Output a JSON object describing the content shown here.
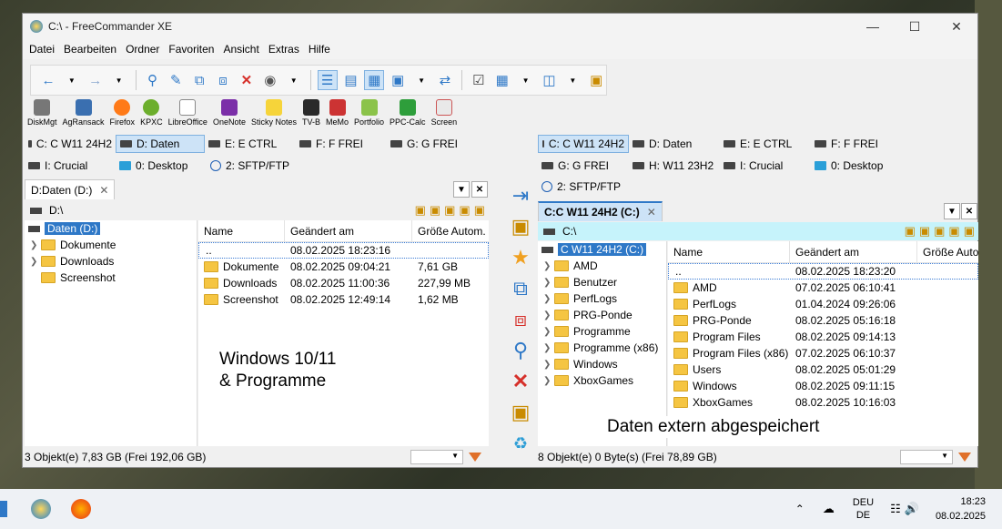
{
  "window": {
    "title": "C:\\ - FreeCommander XE"
  },
  "menu": [
    "Datei",
    "Bearbeiten",
    "Ordner",
    "Favoriten",
    "Ansicht",
    "Extras",
    "Hilfe"
  ],
  "launchers": [
    "DiskMgt",
    "AgRansack",
    "Firefox",
    "KPXC",
    "LibreOffice",
    "OneNote",
    "Sticky Notes",
    "TV-B",
    "MeMo",
    "Portfolio",
    "PPC-Calc",
    "Screen"
  ],
  "left": {
    "drives_row1": [
      "C: C W11 24H2",
      "D: Daten",
      "E: E CTRL",
      "F: F FREI",
      "G: G FREI"
    ],
    "drives_row2": [
      "I: Crucial",
      "0: Desktop",
      "2: SFTP/FTP"
    ],
    "tab": "D:Daten (D:)",
    "path": "D:\\",
    "tree_root": "Daten (D:)",
    "tree": [
      "Dokumente",
      "Downloads",
      "Screenshot"
    ],
    "columns": [
      "Name",
      "Geändert am",
      "Größe Autom."
    ],
    "rows": [
      {
        "name": "..",
        "date": "08.02.2025 18:23:16",
        "size": ""
      },
      {
        "name": "Dokumente",
        "date": "08.02.2025 09:04:21",
        "size": "7,61 GB"
      },
      {
        "name": "Downloads",
        "date": "08.02.2025 11:00:36",
        "size": "227,99 MB"
      },
      {
        "name": "Screenshot",
        "date": "08.02.2025 12:49:14",
        "size": "1,62 MB"
      }
    ],
    "status": "3 Objekt(e)   7,83 GB   (Frei 192,06 GB)"
  },
  "right": {
    "drives_row1": [
      "C: C W11 24H2",
      "D: Daten",
      "E: E CTRL",
      "F: F FREI"
    ],
    "drives_row2": [
      "G: G FREI",
      "H: W11 23H2",
      "I: Crucial",
      "0: Desktop"
    ],
    "drives_row3": [
      "2: SFTP/FTP"
    ],
    "tab": "C:C W11 24H2 (C:)",
    "path": "C:\\",
    "tree_root": "C W11 24H2 (C:)",
    "tree": [
      "AMD",
      "Benutzer",
      "PerfLogs",
      "PRG-Ponde",
      "Programme",
      "Programme (x86)",
      "Windows",
      "XboxGames"
    ],
    "columns": [
      "Name",
      "Geändert am",
      "Größe Autom."
    ],
    "rows": [
      {
        "name": "..",
        "date": "08.02.2025 18:23:20"
      },
      {
        "name": "AMD",
        "date": "07.02.2025 06:10:41"
      },
      {
        "name": "PerfLogs",
        "date": "01.04.2024 09:26:06"
      },
      {
        "name": "PRG-Ponde",
        "date": "08.02.2025 05:16:18"
      },
      {
        "name": "Program Files",
        "date": "08.02.2025 09:14:13"
      },
      {
        "name": "Program Files (x86)",
        "date": "07.02.2025 06:10:37"
      },
      {
        "name": "Users",
        "date": "08.02.2025 05:01:29"
      },
      {
        "name": "Windows",
        "date": "08.02.2025 09:11:15"
      },
      {
        "name": "XboxGames",
        "date": "08.02.2025 10:16:03"
      }
    ],
    "status": "8 Objekt(e)   0 Byte(s)   (Frei 78,89 GB)"
  },
  "annotations": {
    "left_line1": "Windows 10/11",
    "left_line2": "& Programme",
    "right": "Daten extern abgespeichert"
  },
  "tray": {
    "lang1": "DEU",
    "lang2": "DE",
    "time": "18:23",
    "date": "08.02.2025"
  }
}
